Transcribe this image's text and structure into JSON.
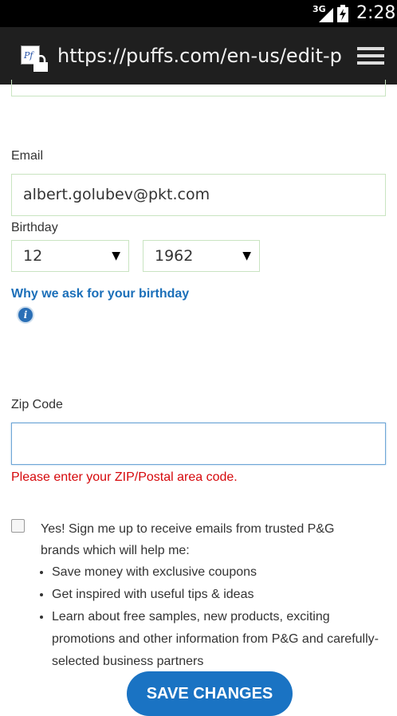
{
  "status_bar": {
    "network": "3G",
    "time": "2:28"
  },
  "browser": {
    "url": "https://puffs.com/en-us/edit-pr"
  },
  "form": {
    "email": {
      "label": "Email",
      "value": "albert.golubev@pkt.com"
    },
    "birthday": {
      "label": "Birthday",
      "month": "12",
      "year": "1962"
    },
    "why_link": "Why we ask for your birthday",
    "info_icon_glyph": "i",
    "zip": {
      "label": "Zip Code",
      "value": "",
      "error": "Please enter your ZIP/Postal area code."
    },
    "optin": {
      "text": "Yes! Sign me up to receive emails from trusted P&G brands which will help me:",
      "checked": false,
      "bullets": [
        "Save money with exclusive coupons",
        "Get inspired with useful tips & ideas",
        "Learn about free samples, new products, exciting promotions and other information from P&G and carefully-selected business partners"
      ]
    },
    "save_label": "SAVE CHANGES"
  },
  "colors": {
    "link": "#1b6fb9",
    "error": "#d6080b",
    "button": "#1a73c3",
    "field_border": "#c9e4c1"
  }
}
